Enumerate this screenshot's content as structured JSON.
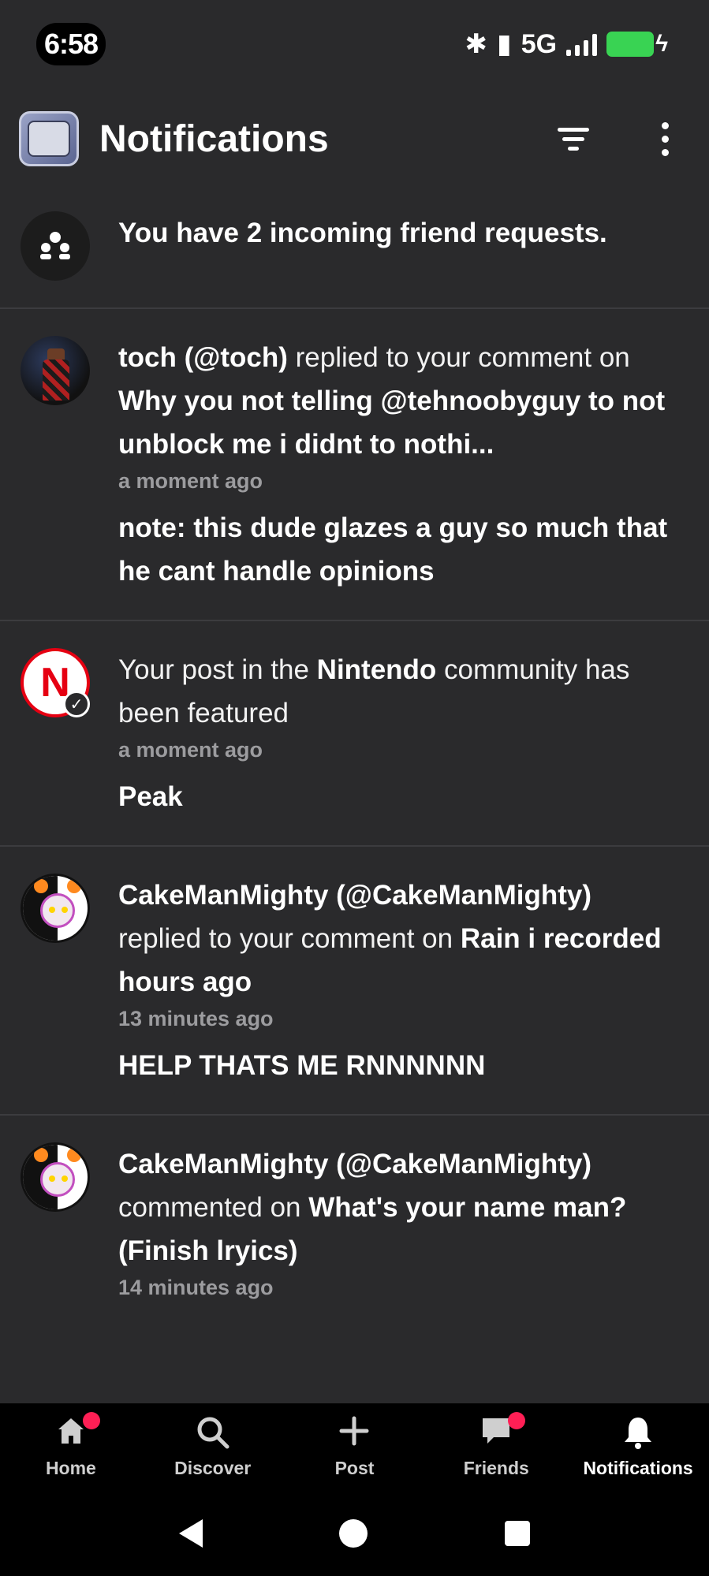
{
  "status_bar": {
    "time": "6:58",
    "network": "5G"
  },
  "header": {
    "title": "Notifications"
  },
  "notifications": [
    {
      "type": "friend_requests",
      "parts": [
        {
          "text": "You have 2 incoming friend requests.",
          "bold": true
        }
      ]
    },
    {
      "type": "reply",
      "actor": "toch (@toch)",
      "action": " replied to your comment on ",
      "target": "Why you not telling @tehnoobyguy to not unblock me i didnt to nothi...",
      "time": "a moment ago",
      "preview": "note: this dude glazes a guy so much that he cant handle opinions"
    },
    {
      "type": "featured",
      "prefix": "Your post in the ",
      "community": "Nintendo",
      "suffix": " community has been featured",
      "time": "a moment ago",
      "preview": "Peak"
    },
    {
      "type": "reply",
      "actor": "CakeManMighty (@CakeManMighty)",
      "action": " replied to your comment on ",
      "target": "Rain i recorded hours ago",
      "time": "13 minutes ago",
      "preview": "HELP THATS ME RNNNNNN"
    },
    {
      "type": "comment",
      "actor": "CakeManMighty (@CakeManMighty)",
      "action": " commented on ",
      "target": "What's your name man? (Finish lryics)",
      "time": "14 minutes ago"
    }
  ],
  "bottom_nav": [
    {
      "label": "Home",
      "icon": "home-icon",
      "badge": true
    },
    {
      "label": "Discover",
      "icon": "search-icon",
      "badge": false
    },
    {
      "label": "Post",
      "icon": "plus-icon",
      "badge": false
    },
    {
      "label": "Friends",
      "icon": "chat-icon",
      "badge": true
    },
    {
      "label": "Notifications",
      "icon": "bell-icon",
      "badge": false,
      "active": true
    }
  ],
  "colors": {
    "background": "#2a2a2c",
    "badge": "#ff1f55",
    "battery": "#39d353",
    "nintendo_red": "#e60012"
  }
}
